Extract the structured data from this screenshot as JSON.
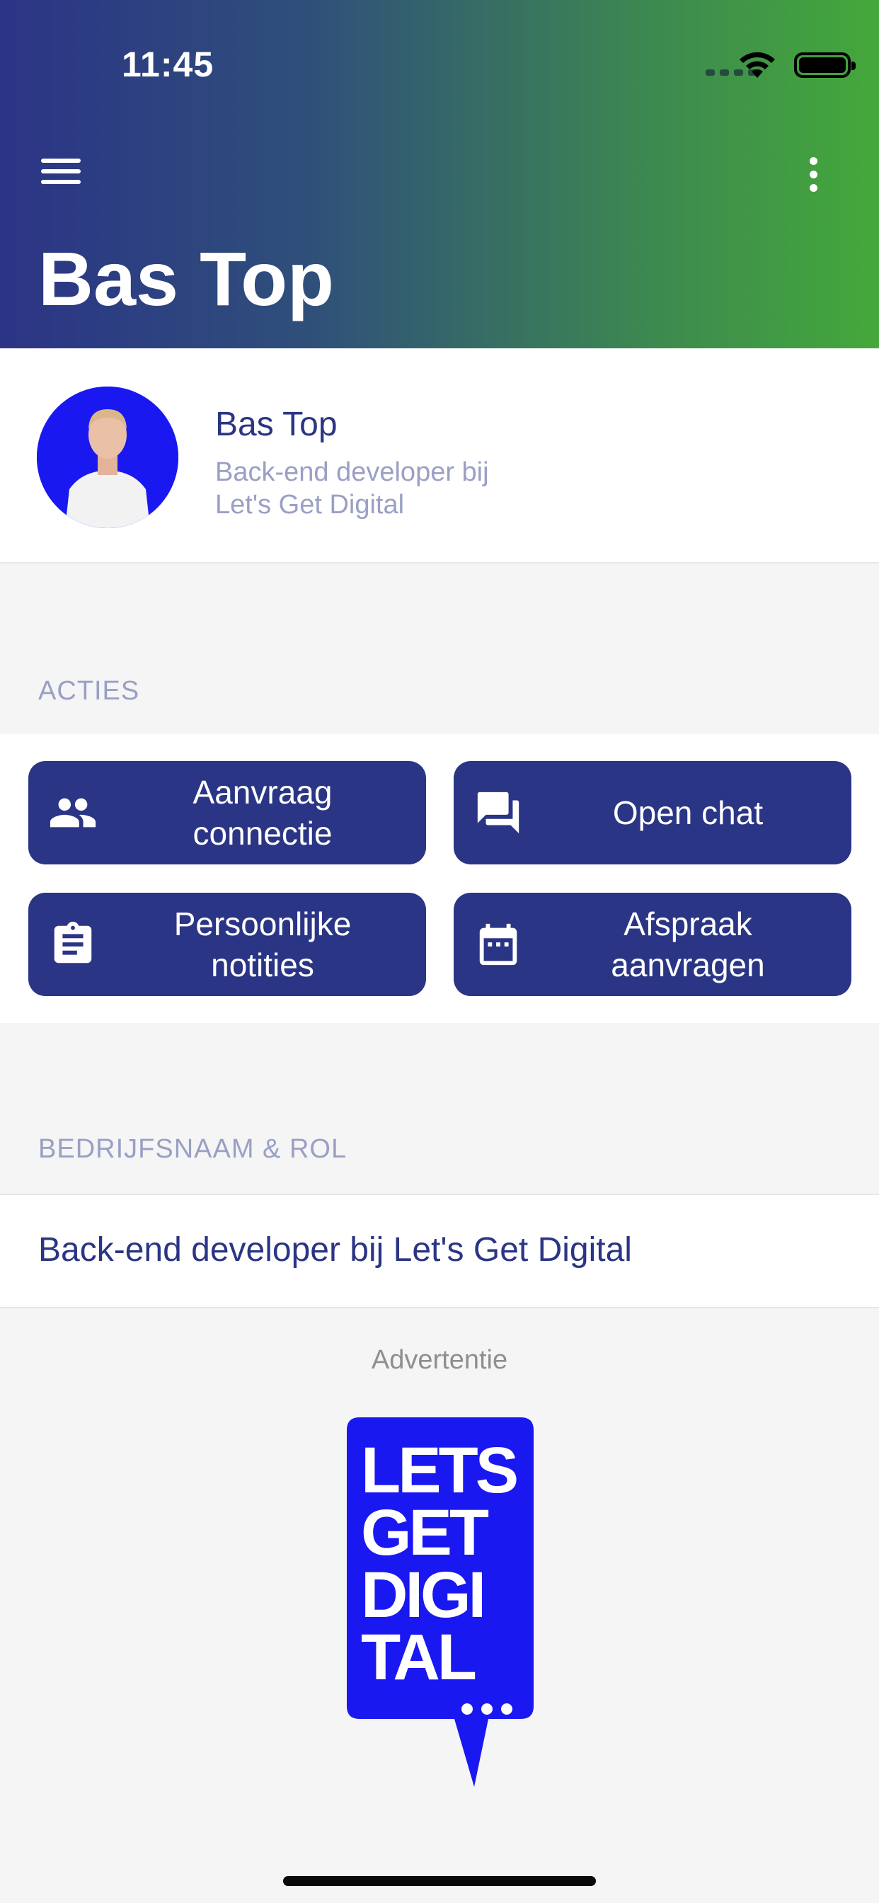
{
  "status_bar": {
    "time": "11:45"
  },
  "header": {
    "title": "Bas Top"
  },
  "profile": {
    "name": "Bas Top",
    "subtitle": "Back-end developer bij\nLet's Get Digital"
  },
  "sections": {
    "actions_label": "ACTIES",
    "company_label": "BEDRIJFSNAAM & ROL"
  },
  "actions": [
    {
      "label": "Aanvraag\nconnectie",
      "icon": "people-icon"
    },
    {
      "label": "Open chat",
      "icon": "chat-icon"
    },
    {
      "label": "Persoonlijke\nnotities",
      "icon": "clipboard-icon"
    },
    {
      "label": "Afspraak\naanvragen",
      "icon": "calendar-icon"
    }
  ],
  "company": {
    "text": "Back-end developer bij Let's Get Digital"
  },
  "ad": {
    "label": "Advertentie",
    "logo_lines": [
      "LETS",
      "GET",
      "DIGI",
      "TAL"
    ]
  },
  "colors": {
    "primary": "#2b3585",
    "muted": "#9aa0c4",
    "gradient_start": "#2b3486",
    "gradient_end": "#44a83a",
    "logo_blue": "#1a18f0"
  }
}
